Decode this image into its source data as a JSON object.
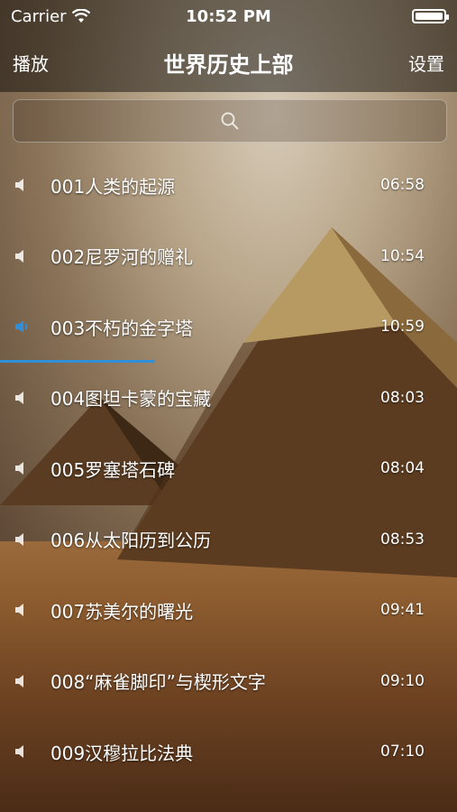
{
  "status_bar": {
    "carrier": "Carrier",
    "time": "10:52 PM",
    "wifi_icon": "wifi-icon",
    "battery_icon": "battery-icon"
  },
  "nav": {
    "left": "播放",
    "title": "世界历史上部",
    "right": "设置"
  },
  "search": {
    "icon": "search-icon"
  },
  "colors": {
    "accent": "#2f8fd8"
  },
  "tracks": [
    {
      "title": "001人类的起源",
      "duration": "06:58",
      "playing": false
    },
    {
      "title": "002尼罗河的赠礼",
      "duration": "10:54",
      "playing": false
    },
    {
      "title": "003不朽的金字塔",
      "duration": "10:59",
      "playing": true,
      "progress": 0.34
    },
    {
      "title": "004图坦卡蒙的宝藏",
      "duration": "08:03",
      "playing": false
    },
    {
      "title": "005罗塞塔石碑",
      "duration": "08:04",
      "playing": false
    },
    {
      "title": "006从太阳历到公历",
      "duration": "08:53",
      "playing": false
    },
    {
      "title": "007苏美尔的曙光",
      "duration": "09:41",
      "playing": false
    },
    {
      "title": "008“麻雀脚印”与楔形文字",
      "duration": "09:10",
      "playing": false
    },
    {
      "title": "009汉穆拉比法典",
      "duration": "07:10",
      "playing": false
    }
  ]
}
